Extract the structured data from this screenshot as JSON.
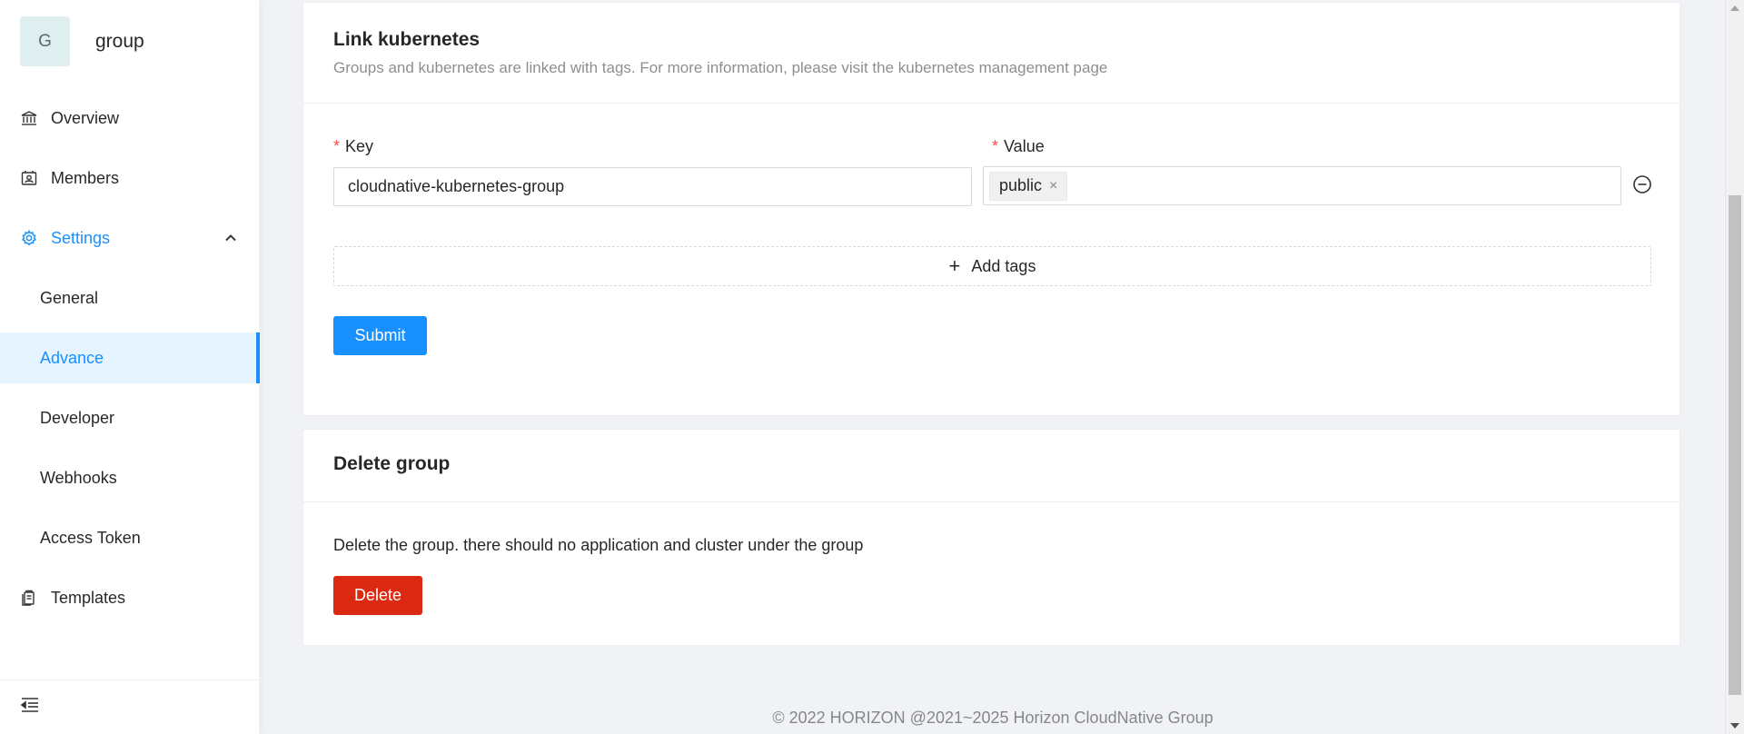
{
  "sidebar": {
    "avatar_letter": "G",
    "group_name": "group",
    "items": [
      {
        "label": "Overview",
        "icon": "bank-icon"
      },
      {
        "label": "Members",
        "icon": "contacts-icon"
      },
      {
        "label": "Settings",
        "icon": "gear-icon",
        "expanded": true
      },
      {
        "label": "General"
      },
      {
        "label": "Advance",
        "selected": true
      },
      {
        "label": "Developer"
      },
      {
        "label": "Webhooks"
      },
      {
        "label": "Access Token"
      },
      {
        "label": "Templates",
        "icon": "snippets-icon"
      }
    ],
    "collapse_icon": "menu-fold-icon"
  },
  "link_card": {
    "title": "Link kubernetes",
    "description": "Groups and kubernetes are linked with tags. For more information, please visit the kubernetes management page",
    "key_label": "Key",
    "value_label": "Value",
    "required_mark": "*",
    "key_value": "cloudnative-kubernetes-group",
    "value_tags": [
      "public"
    ],
    "tag_close": "×",
    "add_tags_label": "Add tags",
    "add_icon": "+",
    "submit_label": "Submit"
  },
  "delete_card": {
    "title": "Delete group",
    "description": "Delete the group. there should no application and cluster under the group",
    "delete_label": "Delete"
  },
  "footer": {
    "copyright_symbol": "©",
    "text": "2022 HORIZON @2021~2025 Horizon CloudNative Group"
  },
  "colors": {
    "primary": "#1890ff",
    "danger": "#dc2a12",
    "required": "#ff4d4f"
  }
}
